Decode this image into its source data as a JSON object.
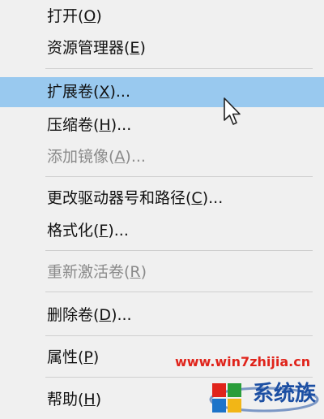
{
  "menu": {
    "items": [
      {
        "label": "打开(",
        "mnemonic": "O",
        "suffix": ")",
        "state": "normal"
      },
      {
        "label": "资源管理器(",
        "mnemonic": "E",
        "suffix": ")",
        "state": "normal"
      },
      {
        "label": "扩展卷(",
        "mnemonic": "X",
        "suffix": ")...",
        "state": "hover"
      },
      {
        "label": "压缩卷(",
        "mnemonic": "H",
        "suffix": ")...",
        "state": "normal"
      },
      {
        "label": "添加镜像(",
        "mnemonic": "A",
        "suffix": ")...",
        "state": "disabled"
      },
      {
        "label": "更改驱动器号和路径(",
        "mnemonic": "C",
        "suffix": ")...",
        "state": "normal"
      },
      {
        "label": "格式化(",
        "mnemonic": "F",
        "suffix": ")...",
        "state": "normal"
      },
      {
        "label": "重新激活卷(",
        "mnemonic": "R",
        "suffix": ")",
        "state": "disabled"
      },
      {
        "label": "删除卷(",
        "mnemonic": "D",
        "suffix": ")...",
        "state": "normal"
      },
      {
        "label": "属性(",
        "mnemonic": "P",
        "suffix": ")",
        "state": "normal"
      },
      {
        "label": "帮助(",
        "mnemonic": "H",
        "suffix": ")",
        "state": "normal"
      }
    ]
  },
  "watermark": {
    "url": "www.win7zhijia.cn",
    "logo_text": "系统族"
  },
  "colors": {
    "hover": "#99c9ef",
    "disabled_text": "#8a8a8a",
    "watermark_red": "#e0241b",
    "watermark_blue": "#1c4fa3"
  },
  "cursor_icon": "arrow-cursor-icon"
}
